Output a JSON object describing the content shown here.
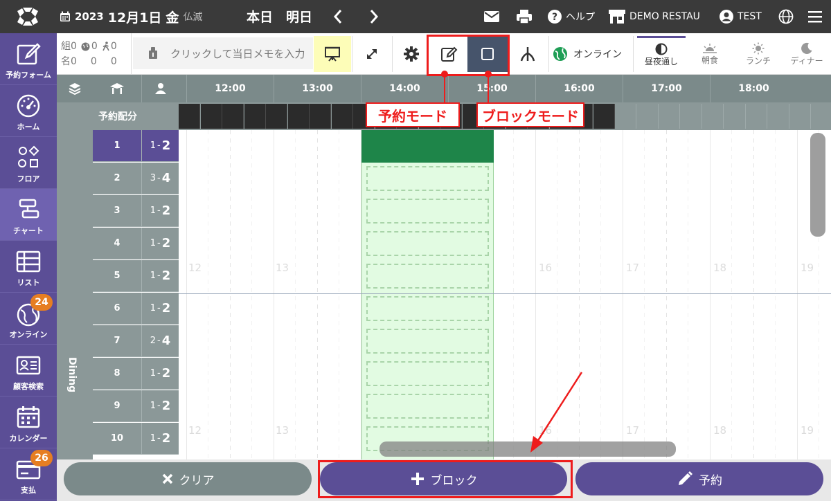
{
  "header": {
    "year": "2023",
    "month_day": "12月1日",
    "day_of_week": "金",
    "rokuyo": "仏滅",
    "today_label": "本日",
    "tomorrow_label": "明日",
    "help_label": "ヘルプ",
    "restaurant_label": "DEMO RESTAU",
    "user_label": "TEST"
  },
  "sidebar": {
    "items": [
      {
        "label": "予約フォーム",
        "icon": "edit-icon"
      },
      {
        "label": "ホーム",
        "icon": "gauge-icon"
      },
      {
        "label": "フロア",
        "icon": "shapes-icon"
      },
      {
        "label": "チャート",
        "icon": "chart-icon"
      },
      {
        "label": "リスト",
        "icon": "table-icon"
      },
      {
        "label": "オンライン",
        "icon": "globe-icon",
        "badge": "24"
      },
      {
        "label": "顧客検索",
        "icon": "id-card-icon"
      },
      {
        "label": "カレンダー",
        "icon": "calendar-icon"
      },
      {
        "label": "支払",
        "icon": "card-icon",
        "badge": "26"
      }
    ]
  },
  "toolbar": {
    "stats": {
      "groups_label": "組",
      "groups_total": "0",
      "groups_online": "0",
      "groups_walkin": "0",
      "people_label": "名",
      "people_total": "0",
      "people_online": "0",
      "people_walkin": "0"
    },
    "memo_placeholder": "クリックして当日メモを入力",
    "online_label": "オンライン",
    "meals": [
      {
        "label": "昼夜通し",
        "active": true
      },
      {
        "label": "朝食",
        "active": false
      },
      {
        "label": "ランチ",
        "active": false
      },
      {
        "label": "ディナー",
        "active": false
      }
    ]
  },
  "chart": {
    "allocation_label": "予約配分",
    "area_label": "Dining",
    "hours": [
      "12:00",
      "13:00",
      "14:00",
      "15:00",
      "16:00",
      "17:00",
      "18:00"
    ],
    "watermark_row1": [
      "12",
      "13",
      "16",
      "17",
      "18",
      "19"
    ],
    "watermark_row2": [
      "12",
      "13",
      "16",
      "17",
      "18",
      "19"
    ],
    "tables": [
      {
        "num": "1",
        "min": "1",
        "max": "2"
      },
      {
        "num": "2",
        "min": "3",
        "max": "4"
      },
      {
        "num": "3",
        "min": "1",
        "max": "2"
      },
      {
        "num": "4",
        "min": "1",
        "max": "2"
      },
      {
        "num": "5",
        "min": "1",
        "max": "2"
      },
      {
        "num": "6",
        "min": "1",
        "max": "2"
      },
      {
        "num": "7",
        "min": "2",
        "max": "4"
      },
      {
        "num": "8",
        "min": "1",
        "max": "2"
      },
      {
        "num": "9",
        "min": "1",
        "max": "2"
      },
      {
        "num": "10",
        "min": "1",
        "max": "2"
      }
    ],
    "cap_separator": "-"
  },
  "bottom": {
    "clear_label": "クリア",
    "block_label": "ブロック",
    "reserve_label": "予約"
  },
  "annotations": {
    "reserve_mode": "予約モード",
    "block_mode": "ブロックモード"
  },
  "colors": {
    "accent": "#5b4e96",
    "topbar": "#3a3a3a",
    "annotation": "#ee1c1c",
    "block_green": "#1e8549"
  }
}
